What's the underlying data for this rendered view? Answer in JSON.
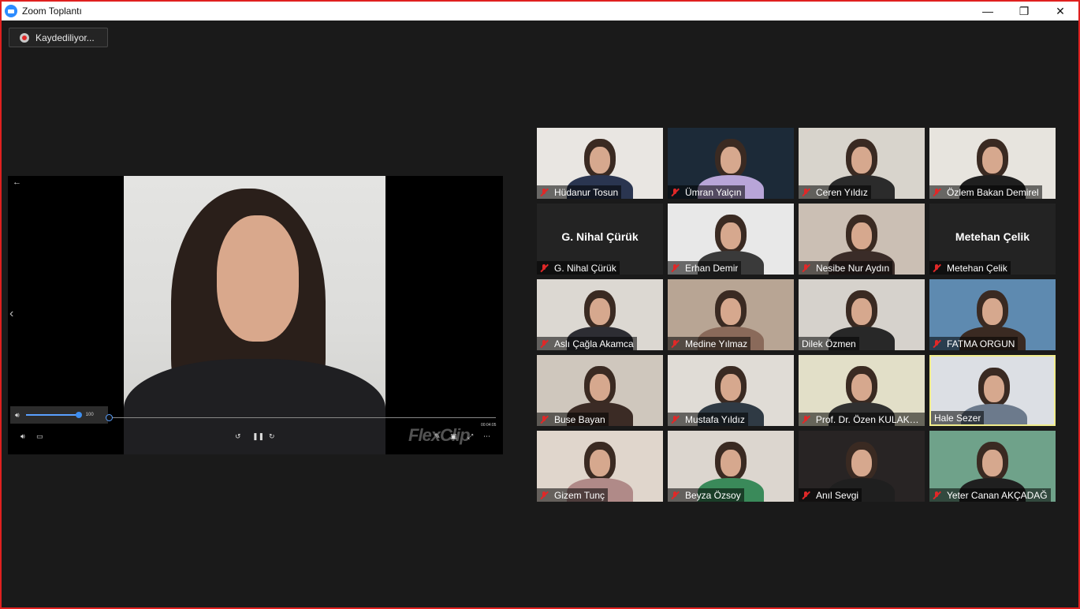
{
  "window": {
    "title": "Zoom Toplantı",
    "controls": {
      "minimize": "—",
      "restore": "❐",
      "close": "✕"
    }
  },
  "recording": {
    "label": "Kaydediliyor..."
  },
  "player": {
    "volume": "100",
    "time": "00:04:05",
    "watermark": "FlexClip",
    "icons": [
      "back-arrow-icon",
      "chevron-left-icon",
      "volume-icon",
      "subtitles-icon",
      "rewind-icon",
      "pause-icon",
      "forward-icon",
      "edit-icon",
      "cast-icon",
      "expand-icon",
      "more-icon"
    ]
  },
  "gallery": {
    "tiles": [
      {
        "name": "Hüdanur Tosun",
        "muted": true,
        "bg": "#e9e6e2",
        "shirt": "#2a3550"
      },
      {
        "name": "Ümran Yalçın",
        "muted": true,
        "bg": "#1c2a38",
        "shirt": "#b8a5d8"
      },
      {
        "name": "Ceren Yıldız",
        "muted": true,
        "bg": "#d8d4cc",
        "shirt": "#2b2b2b"
      },
      {
        "name": "Özlem Bakan Demirel",
        "muted": true,
        "bg": "#e7e4de",
        "shirt": "#1f1f1f"
      },
      {
        "name": "G. Nihal Çürük",
        "muted": true,
        "video": false
      },
      {
        "name": "Erhan Demir",
        "muted": true,
        "bg": "#e8e8e8",
        "shirt": "#3a3a3a"
      },
      {
        "name": "Nesibe Nur Aydın",
        "muted": true,
        "bg": "#cbbfb4",
        "shirt": "#3a2c28"
      },
      {
        "name": "Metehan Çelik",
        "muted": true,
        "video": false
      },
      {
        "name": "Aslı Çağla Akamca",
        "muted": true,
        "bg": "#dcd8d2",
        "shirt": "#2d2d33"
      },
      {
        "name": "Medine Yılmaz",
        "muted": true,
        "bg": "#b8a594",
        "shirt": "#8a6a5a"
      },
      {
        "name": "Dilek Özmen",
        "muted": false,
        "bg": "#d6d2cc",
        "shirt": "#282828"
      },
      {
        "name": "FATMA ORGUN",
        "muted": true,
        "bg": "#5e8ab0",
        "shirt": "#3a2a22"
      },
      {
        "name": "Buse Bayan",
        "muted": true,
        "bg": "#cfc7bd",
        "shirt": "#3b2b25"
      },
      {
        "name": "Mustafa Yıldız",
        "muted": true,
        "bg": "#e0dcd6",
        "shirt": "#2f3a44"
      },
      {
        "name": "Prof. Dr. Özen KULAKAÇ",
        "muted": true,
        "bg": "#e2dfc8",
        "shirt": "#303030"
      },
      {
        "name": "Hale Sezer",
        "muted": false,
        "active": true,
        "bg": "#dcdfe4",
        "shirt": "#6c7a8c"
      },
      {
        "name": "Gizem Tunç",
        "muted": true,
        "bg": "#e0d6cc",
        "shirt": "#b08a88"
      },
      {
        "name": "Beyza Özsoy",
        "muted": true,
        "bg": "#dcd6cf",
        "shirt": "#3a8a5a"
      },
      {
        "name": "Anıl Sevgi",
        "muted": true,
        "bg": "#282424",
        "shirt": "#1f1f1f"
      },
      {
        "name": "Yeter Canan AKÇADAĞ",
        "muted": true,
        "bg": "#6fa28a",
        "shirt": "#1f1f1f"
      }
    ]
  }
}
